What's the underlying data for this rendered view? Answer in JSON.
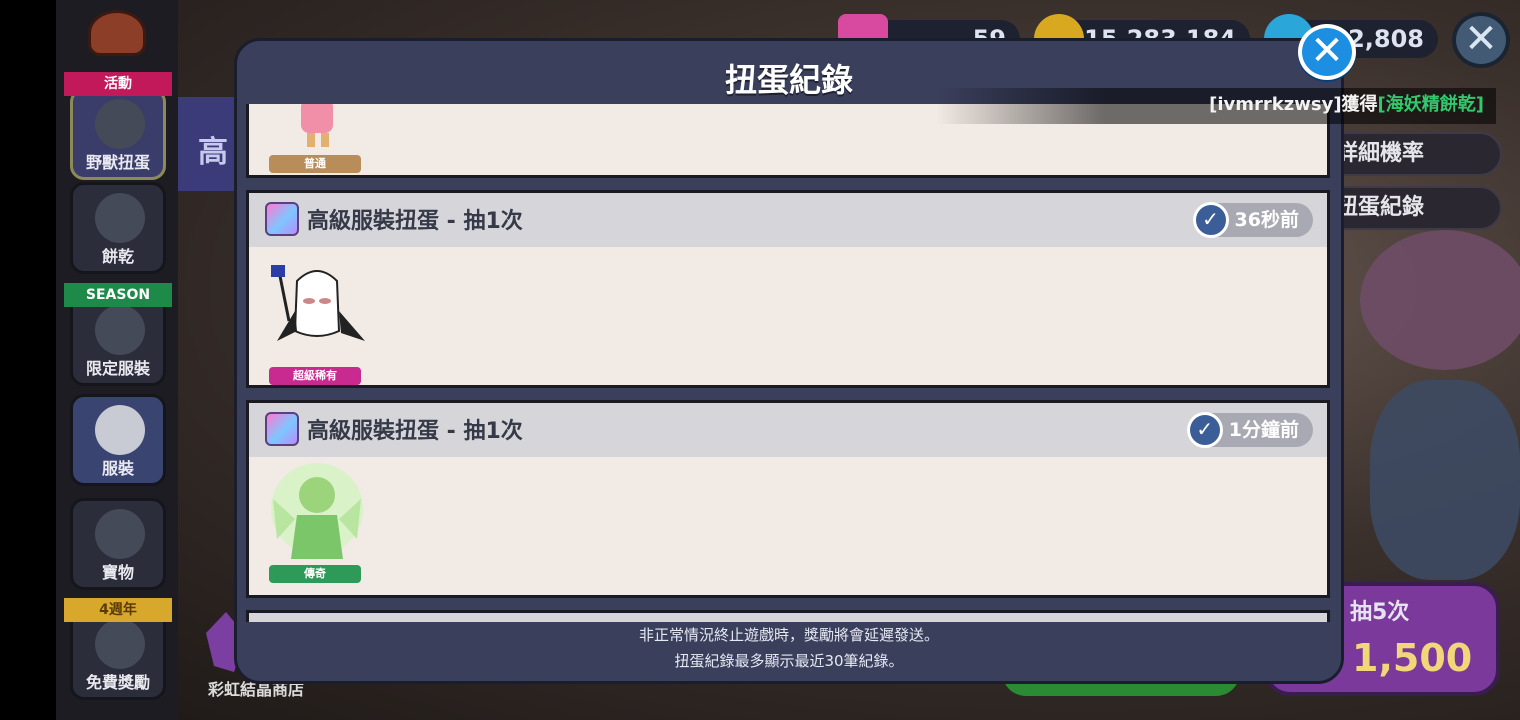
{
  "sidebar": {
    "ribbon_event": "活動",
    "item_beast": "野獸扭蛋",
    "item_cookie": "餅乾",
    "ribbon_season": "SEASON",
    "item_limited": "限定服裝",
    "item_costume": "服裝",
    "item_treasure": "寶物",
    "ribbon_anniv": "4週年",
    "item_free": "免費獎勵"
  },
  "background": {
    "banner_char": "高",
    "rainbow_store": "彩虹結晶商店"
  },
  "currency": {
    "crystal": "59",
    "coins": "15,283,184",
    "gems": "12,808"
  },
  "right_panel": {
    "detail_rate": "詳細機率",
    "gacha_record": "扭蛋紀錄",
    "ticker_user": "[ivmrrkzwsy]獲得",
    "ticker_item": "[海妖精餅乾]",
    "pull5_label": "抽5次",
    "pull5_price": "1,500"
  },
  "modal": {
    "title": "扭蛋紀錄",
    "records": [
      {
        "title": "",
        "time": "",
        "rarity": "普通"
      },
      {
        "title": "高級服裝扭蛋 - 抽1次",
        "time": "36秒前",
        "rarity": "超級稀有"
      },
      {
        "title": "高級服裝扭蛋 - 抽1次",
        "time": "1分鐘前",
        "rarity": "傳奇"
      }
    ],
    "footer_line1": "非正常情況終止遊戲時，獎勵將會延遲發送。",
    "footer_line2": "扭蛋紀錄最多顯示最近30筆紀錄。"
  }
}
